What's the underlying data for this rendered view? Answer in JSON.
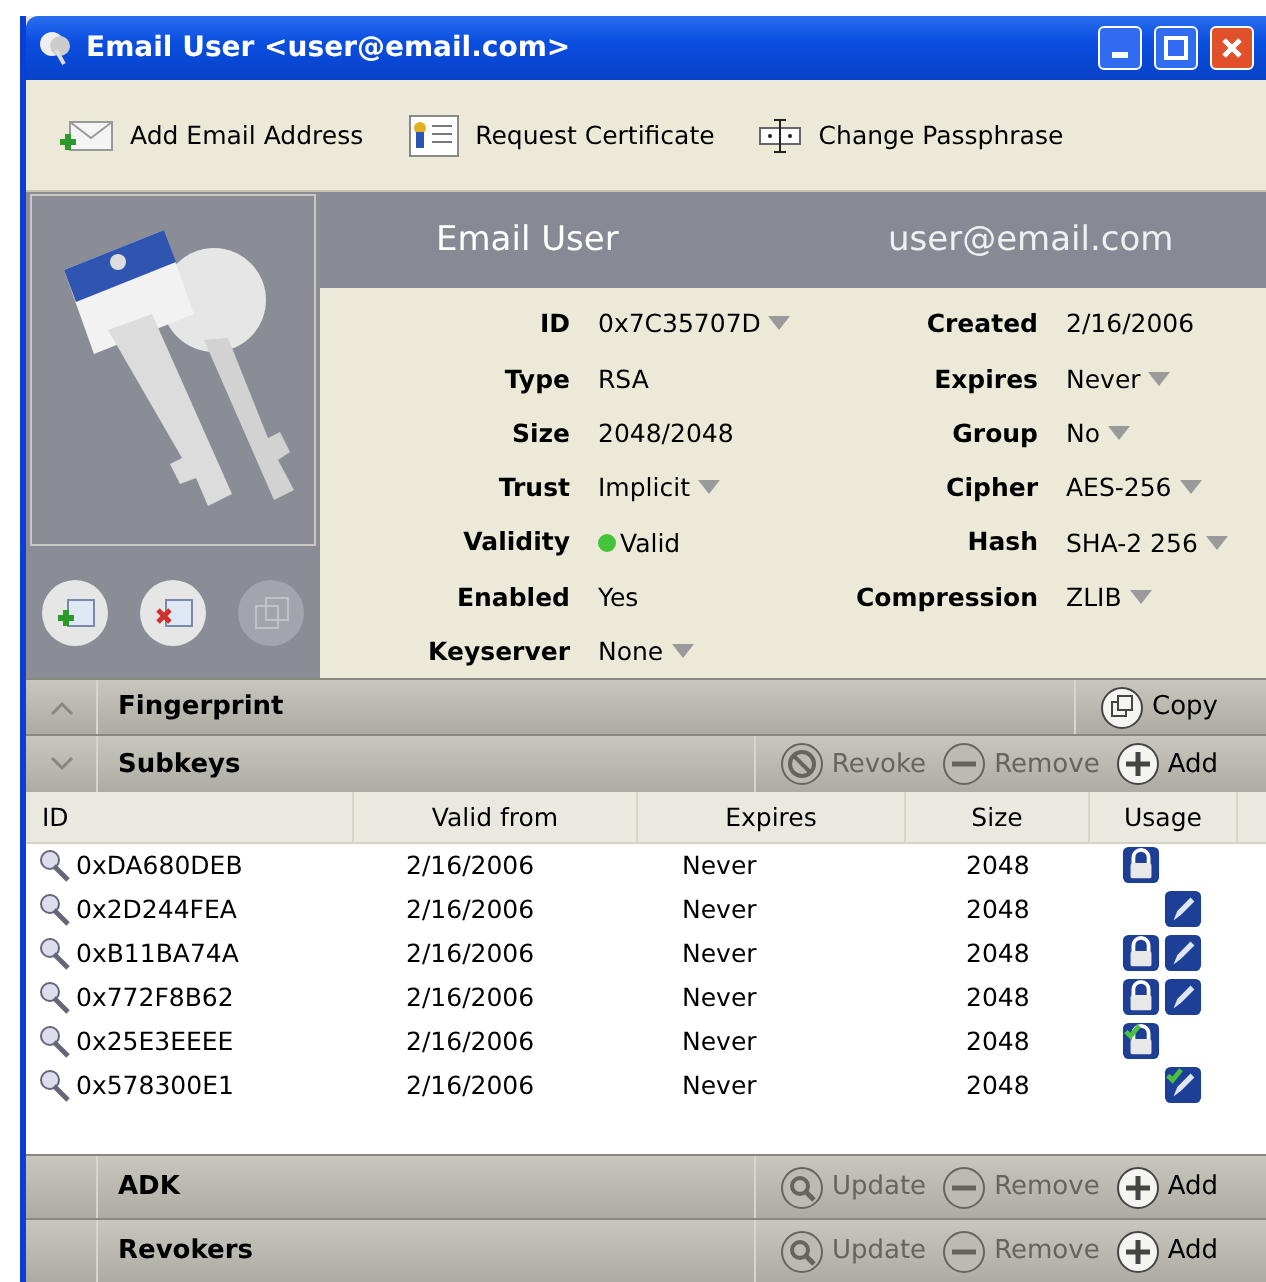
{
  "window": {
    "title": "Email User <user@email.com>"
  },
  "toolbar": [
    {
      "kind": "add-email",
      "label": "Add Email Address"
    },
    {
      "kind": "certificate",
      "label": "Request Certificate"
    },
    {
      "kind": "passphrase",
      "label": "Change Passphrase"
    }
  ],
  "key_actions": [
    {
      "kind": "add",
      "disabled": false
    },
    {
      "kind": "delete",
      "disabled": false
    },
    {
      "kind": "copy",
      "disabled": true
    }
  ],
  "header": {
    "name": "Email User",
    "email": "user@email.com"
  },
  "fields_left": [
    {
      "label": "ID",
      "value": "0x7C35707D",
      "dropdown": true
    },
    {
      "label": "Type",
      "value": "RSA",
      "dropdown": false
    },
    {
      "label": "Size",
      "value": "2048/2048",
      "dropdown": false
    },
    {
      "label": "Trust",
      "value": "Implicit",
      "dropdown": true
    },
    {
      "label": "Validity",
      "value": "Valid",
      "dropdown": false,
      "valid": true
    },
    {
      "label": "Enabled",
      "value": "Yes",
      "dropdown": false
    },
    {
      "label": "Keyserver",
      "value": "None",
      "dropdown": true
    }
  ],
  "fields_right": [
    {
      "label": "Created",
      "value": "2/16/2006",
      "dropdown": false
    },
    {
      "label": "Expires",
      "value": "Never",
      "dropdown": true
    },
    {
      "label": "Group",
      "value": "No",
      "dropdown": true
    },
    {
      "label": "Cipher",
      "value": "AES-256",
      "dropdown": true
    },
    {
      "label": "Hash",
      "value": "SHA-2 256",
      "dropdown": true
    },
    {
      "label": "Compression",
      "value": "ZLIB",
      "dropdown": true
    }
  ],
  "fingerprint": {
    "title": "Fingerprint",
    "expanded": false,
    "buttons": [
      {
        "kind": "copy",
        "label": "Copy",
        "disabled": false
      }
    ]
  },
  "subkeys": {
    "title": "Subkeys",
    "expanded": true,
    "buttons": [
      {
        "kind": "revoke",
        "label": "Revoke",
        "disabled": true
      },
      {
        "kind": "remove",
        "label": "Remove",
        "disabled": true
      },
      {
        "kind": "add",
        "label": "Add",
        "disabled": false
      }
    ],
    "columns": [
      "ID",
      "Valid from",
      "Expires",
      "Size",
      "Usage"
    ],
    "rows": [
      {
        "id": "0xDA680DEB",
        "valid_from": "2/16/2006",
        "expires": "Never",
        "size": "2048",
        "usage": [
          {
            "kind": "lock",
            "verified": false
          }
        ]
      },
      {
        "id": "0x2D244FEA",
        "valid_from": "2/16/2006",
        "expires": "Never",
        "size": "2048",
        "usage": [
          {
            "kind": "pen",
            "verified": false
          }
        ]
      },
      {
        "id": "0xB11BA74A",
        "valid_from": "2/16/2006",
        "expires": "Never",
        "size": "2048",
        "usage": [
          {
            "kind": "lock",
            "verified": false
          },
          {
            "kind": "pen",
            "verified": false
          }
        ]
      },
      {
        "id": "0x772F8B62",
        "valid_from": "2/16/2006",
        "expires": "Never",
        "size": "2048",
        "usage": [
          {
            "kind": "lock",
            "verified": false
          },
          {
            "kind": "pen",
            "verified": false
          }
        ]
      },
      {
        "id": "0x25E3EEEE",
        "valid_from": "2/16/2006",
        "expires": "Never",
        "size": "2048",
        "usage": [
          {
            "kind": "lock",
            "verified": true
          }
        ]
      },
      {
        "id": "0x578300E1",
        "valid_from": "2/16/2006",
        "expires": "Never",
        "size": "2048",
        "usage": [
          {
            "kind": "pen",
            "verified": true
          }
        ]
      }
    ]
  },
  "adk": {
    "title": "ADK",
    "buttons": [
      {
        "kind": "update",
        "label": "Update",
        "disabled": true
      },
      {
        "kind": "remove",
        "label": "Remove",
        "disabled": true
      },
      {
        "kind": "add",
        "label": "Add",
        "disabled": false
      }
    ]
  },
  "revokers": {
    "title": "Revokers",
    "buttons": [
      {
        "kind": "update",
        "label": "Update",
        "disabled": true
      },
      {
        "kind": "remove",
        "label": "Remove",
        "disabled": true
      },
      {
        "kind": "add",
        "label": "Add",
        "disabled": false
      }
    ]
  }
}
